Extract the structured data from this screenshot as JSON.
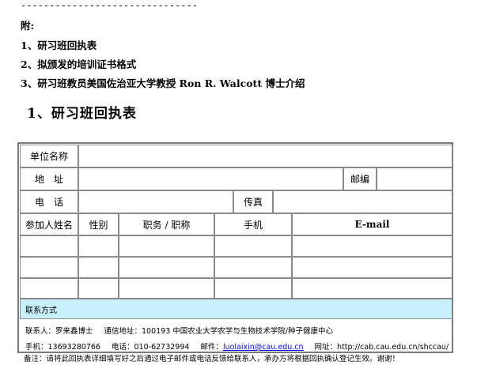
{
  "separator": "-------------------------------",
  "attachments": {
    "title": "附:",
    "items": [
      "1、研习班回执表",
      "2、拟颁发的培训证书格式",
      "3、研习班教员美国佐治亚大学教授 Ron R. Walcott 博士介绍"
    ]
  },
  "section_heading": "1、研习班回执表",
  "form": {
    "unit_name_label": "单位名称",
    "address_label": "地　址",
    "postcode_label": "邮编",
    "phone_label": "电　话",
    "fax_label": "传真",
    "columns": [
      "参加人姓名",
      "性别",
      "职务 / 职称",
      "手机",
      "E-mail"
    ],
    "contact_section_label": "联系方式",
    "contact_line1": {
      "contact_person": "联系人：罗来鑫博士",
      "address": "通信地址：100193  中国农业大学农学与生物技术学院/种子健康中心"
    },
    "contact_line2": {
      "mobile": "手机：13693280766",
      "phone": "电话：010-62732994",
      "email_label": "邮件：",
      "email": "luolaixin@cau.edu.cn",
      "website": "网址：http://cab.cau.edu.cn/shccau/"
    }
  },
  "note": "备注：请将此回执表详细填写好之后通过电子邮件或电话反馈给联系人，承办方将根据回执确认登记生效。谢谢！"
}
